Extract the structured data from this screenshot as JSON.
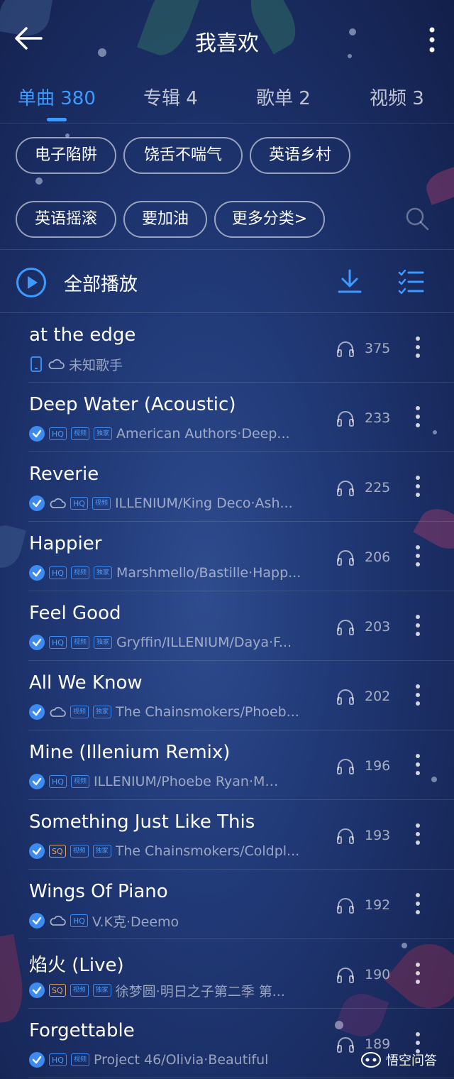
{
  "header": {
    "title": "我喜欢"
  },
  "tabs": [
    {
      "label": "单曲 380"
    },
    {
      "label": "专辑 4"
    },
    {
      "label": "歌单 2"
    },
    {
      "label": "视频 3"
    }
  ],
  "chips": [
    {
      "label": "电子陷阱"
    },
    {
      "label": "饶舌不喘气"
    },
    {
      "label": "英语乡村"
    },
    {
      "label": "英语摇滚"
    },
    {
      "label": "要加油"
    },
    {
      "label": "更多分类>"
    }
  ],
  "play_all": {
    "label": "全部播放"
  },
  "badges": {
    "hq": "HQ",
    "sq": "SQ",
    "video": "视频",
    "exclusive": "独家"
  },
  "songs": [
    {
      "title": "at the edge",
      "artist": "未知歌手",
      "plays": "375"
    },
    {
      "title": "Deep Water (Acoustic)",
      "artist": "American Authors·Deep...",
      "plays": "233"
    },
    {
      "title": "Reverie",
      "artist": "ILLENIUM/King Deco·Ash...",
      "plays": "225"
    },
    {
      "title": "Happier",
      "artist": "Marshmello/Bastille·Happ...",
      "plays": "206"
    },
    {
      "title": "Feel Good",
      "artist": "Gryffin/ILLENIUM/Daya·F...",
      "plays": "203"
    },
    {
      "title": "All We Know",
      "artist": "The Chainsmokers/Phoeb...",
      "plays": "202"
    },
    {
      "title": "Mine (Illenium Remix)",
      "artist": "ILLENIUM/Phoebe Ryan·Mine...",
      "plays": "196"
    },
    {
      "title": "Something Just Like This",
      "artist": "The Chainsmokers/Coldpl...",
      "plays": "193"
    },
    {
      "title": "Wings Of Piano",
      "artist": "V.K克·Deemo",
      "plays": "192"
    },
    {
      "title": "焰火 (Live)",
      "artist": "徐梦圆·明日之子第二季 第...",
      "plays": "190"
    },
    {
      "title": "Forgettable",
      "artist": "Project 46/Olivia·Beautiful",
      "plays": "189"
    }
  ],
  "watermark": {
    "text": "悟空问答"
  },
  "colors": {
    "accent": "#3d9bff",
    "sq": "#e0a45a",
    "background": "#213a78"
  }
}
